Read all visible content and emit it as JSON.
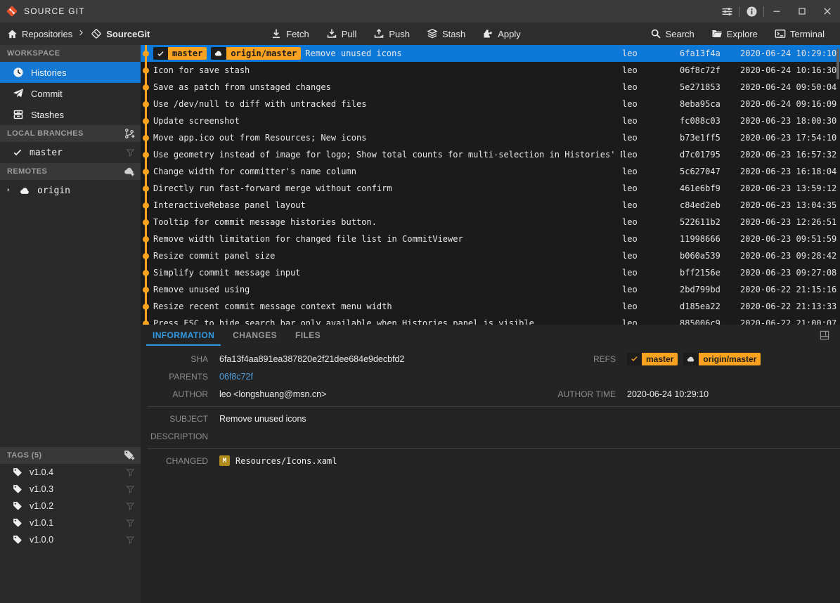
{
  "window": {
    "title": "SOURCE GIT",
    "titlebar_icons": [
      "preferences",
      "about"
    ],
    "controls": [
      "minimize",
      "maximize",
      "close"
    ]
  },
  "toolbar": {
    "breadcrumb": {
      "root": "Repositories",
      "repo": "SourceGit"
    },
    "actions": [
      {
        "label": "Fetch",
        "icon": "fetch"
      },
      {
        "label": "Pull",
        "icon": "pull"
      },
      {
        "label": "Push",
        "icon": "push"
      },
      {
        "label": "Stash",
        "icon": "stash"
      },
      {
        "label": "Apply",
        "icon": "apply"
      }
    ],
    "tools": [
      {
        "label": "Search",
        "icon": "search"
      },
      {
        "label": "Explore",
        "icon": "folder"
      },
      {
        "label": "Terminal",
        "icon": "terminal"
      }
    ]
  },
  "sidebar": {
    "sections": [
      {
        "header": "WORKSPACE",
        "header_icon": null,
        "items": [
          {
            "label": "Histories",
            "icon": "clock",
            "active": true
          },
          {
            "label": "Commit",
            "icon": "send"
          },
          {
            "label": "Stashes",
            "icon": "archive"
          }
        ]
      },
      {
        "header": "LOCAL BRANCHES",
        "header_icon": "branch-add",
        "items": [
          {
            "label": "master",
            "icon": "check",
            "mono": true,
            "filter": true
          }
        ]
      },
      {
        "header": "REMOTES",
        "header_icon": "cloud-add",
        "items": [
          {
            "label": "origin",
            "icon": "cloud",
            "mono": true,
            "expander": true
          }
        ]
      },
      {
        "header": "TAGS (5)",
        "header_icon": "tag-add",
        "tags": true,
        "items": [
          {
            "label": "v1.0.4",
            "icon": "tag",
            "filter": true
          },
          {
            "label": "v1.0.3",
            "icon": "tag",
            "filter": true
          },
          {
            "label": "v1.0.2",
            "icon": "tag",
            "filter": true
          },
          {
            "label": "v1.0.1",
            "icon": "tag",
            "filter": true
          },
          {
            "label": "v1.0.0",
            "icon": "tag",
            "filter": true
          }
        ]
      }
    ]
  },
  "history": {
    "commits": [
      {
        "message": "Remove unused icons",
        "author": "leo",
        "sha": "6fa13f4a",
        "time": "2020-06-24 10:29:10",
        "selected": true,
        "refs": [
          "master",
          "origin/master"
        ]
      },
      {
        "message": "Icon for save stash",
        "author": "leo",
        "sha": "06f8c72f",
        "time": "2020-06-24 10:16:30"
      },
      {
        "message": "Save as patch from unstaged changes",
        "author": "leo",
        "sha": "5e271853",
        "time": "2020-06-24 09:50:04"
      },
      {
        "message": "Use /dev/null to diff with untracked files",
        "author": "leo",
        "sha": "8eba95ca",
        "time": "2020-06-24 09:16:09"
      },
      {
        "message": "Update screenshot",
        "author": "leo",
        "sha": "fc088c03",
        "time": "2020-06-23 18:00:30"
      },
      {
        "message": "Move app.ico out from Resources; New icons",
        "author": "leo",
        "sha": "b73e1ff5",
        "time": "2020-06-23 17:54:10"
      },
      {
        "message": "Use geometry instead of image for logo; Show total counts for multi-selection in Histories' DataGrid",
        "author": "leo",
        "sha": "d7c01795",
        "time": "2020-06-23 16:57:32"
      },
      {
        "message": "Change width for committer's name column",
        "author": "leo",
        "sha": "5c627047",
        "time": "2020-06-23 16:18:04"
      },
      {
        "message": "Directly run fast-forward merge without confirm",
        "author": "leo",
        "sha": "461e6bf9",
        "time": "2020-06-23 13:59:12"
      },
      {
        "message": "InteractiveRebase panel layout",
        "author": "leo",
        "sha": "c84ed2eb",
        "time": "2020-06-23 13:04:35"
      },
      {
        "message": "Tooltip for commit message histories button.",
        "author": "leo",
        "sha": "522611b2",
        "time": "2020-06-23 12:26:51"
      },
      {
        "message": "Remove width limitation for changed file list in CommitViewer",
        "author": "leo",
        "sha": "11998666",
        "time": "2020-06-23 09:51:59"
      },
      {
        "message": "Resize commit panel size",
        "author": "leo",
        "sha": "b060a539",
        "time": "2020-06-23 09:28:42"
      },
      {
        "message": "Simplify commit message input",
        "author": "leo",
        "sha": "bff2156e",
        "time": "2020-06-23 09:27:08"
      },
      {
        "message": "Remove unused using",
        "author": "leo",
        "sha": "2bd799bd",
        "time": "2020-06-22 21:15:16"
      },
      {
        "message": "Resize recent commit message context menu width",
        "author": "leo",
        "sha": "d185ea22",
        "time": "2020-06-22 21:13:33"
      },
      {
        "message": "Press ESC to hide search bar only available when Histories panel is visible",
        "author": "leo",
        "sha": "885006c9",
        "time": "2020-06-22 21:00:07"
      }
    ]
  },
  "detail": {
    "tabs": [
      "INFORMATION",
      "CHANGES",
      "FILES"
    ],
    "active_tab": "INFORMATION",
    "sha_label": "SHA",
    "sha": "6fa13f4aa891ea387820e2f21dee684e9decbfd2",
    "refs_label": "REFS",
    "refs": [
      "master",
      "origin/master"
    ],
    "parents_label": "PARENTS",
    "parents": [
      "06f8c72f"
    ],
    "author_label": "AUTHOR",
    "author": "leo <longshuang@msn.cn>",
    "author_time_label": "AUTHOR TIME",
    "author_time": "2020-06-24 10:29:10",
    "subject_label": "SUBJECT",
    "subject": "Remove unused icons",
    "description_label": "DESCRIPTION",
    "description": "",
    "changed_label": "CHANGED",
    "changed_files": [
      {
        "status": "M",
        "path": "Resources/Icons.xaml"
      }
    ]
  },
  "colors": {
    "accent_orange": "#f8a21f",
    "selection_blue": "#0d78d7",
    "active_tab_blue": "#2e9ae4",
    "link_blue": "#4f9edb",
    "logo_orange_red": "#e2502c",
    "modified_badge": "#b18c1d"
  }
}
